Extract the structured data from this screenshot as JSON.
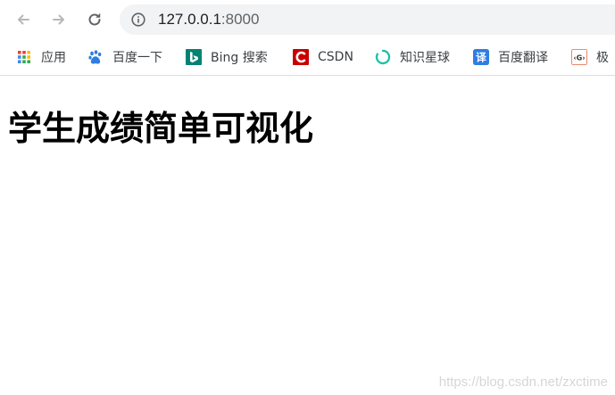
{
  "browser": {
    "url_host": "127.0.0.1",
    "url_port": ":8000"
  },
  "bookmarks": [
    {
      "label": "应用",
      "icon": "apps-grid-icon"
    },
    {
      "label": "百度一下",
      "icon": "baidu-paw-icon"
    },
    {
      "label": "Bing 搜索",
      "icon": "bing-icon"
    },
    {
      "label": "CSDN",
      "icon": "csdn-icon"
    },
    {
      "label": "知识星球",
      "icon": "zsxq-icon"
    },
    {
      "label": "百度翻译",
      "icon": "baidu-translate-icon"
    },
    {
      "label": "极",
      "icon": "g-icon"
    }
  ],
  "colors": {
    "accent": "#1a73e8",
    "csdn_red": "#c80000",
    "bing_teal": "#008373",
    "zsxq_green": "#1cc2a6"
  },
  "page": {
    "title": "学生成绩简单可视化"
  },
  "watermark": "https://blog.csdn.net/zxctime"
}
